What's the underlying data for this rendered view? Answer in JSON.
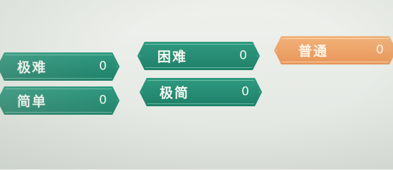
{
  "difficulties": [
    {
      "label": "极难",
      "count": "0"
    },
    {
      "label": "困难",
      "count": "0"
    },
    {
      "label": "普通",
      "count": "0",
      "selected": true
    },
    {
      "label": "简单",
      "count": "0"
    },
    {
      "label": "极简",
      "count": "0"
    }
  ],
  "colors": {
    "accent": "#1f8068",
    "selected": "#e89659"
  }
}
